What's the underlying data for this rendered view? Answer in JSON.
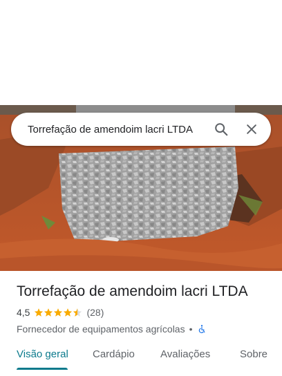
{
  "search": {
    "query": "Torrefação de amendoim lacri LTDA"
  },
  "place": {
    "name": "Torrefação de amendoim lacri LTDA",
    "rating": "4,5",
    "stars_filled": 4.5,
    "review_count": "(28)",
    "category": "Fornecedor de equipamentos agrícolas",
    "separator": "•"
  },
  "tabs": [
    {
      "label": "Visão geral"
    },
    {
      "label": "Cardápio"
    },
    {
      "label": "Avaliações"
    },
    {
      "label": "Sobre"
    }
  ],
  "colors": {
    "accent": "#0b7a8c",
    "star": "#f9ab00",
    "accessibility": "#1a73e8"
  },
  "icons": [
    "search-icon",
    "close-icon",
    "star-icon",
    "wheelchair-icon"
  ]
}
